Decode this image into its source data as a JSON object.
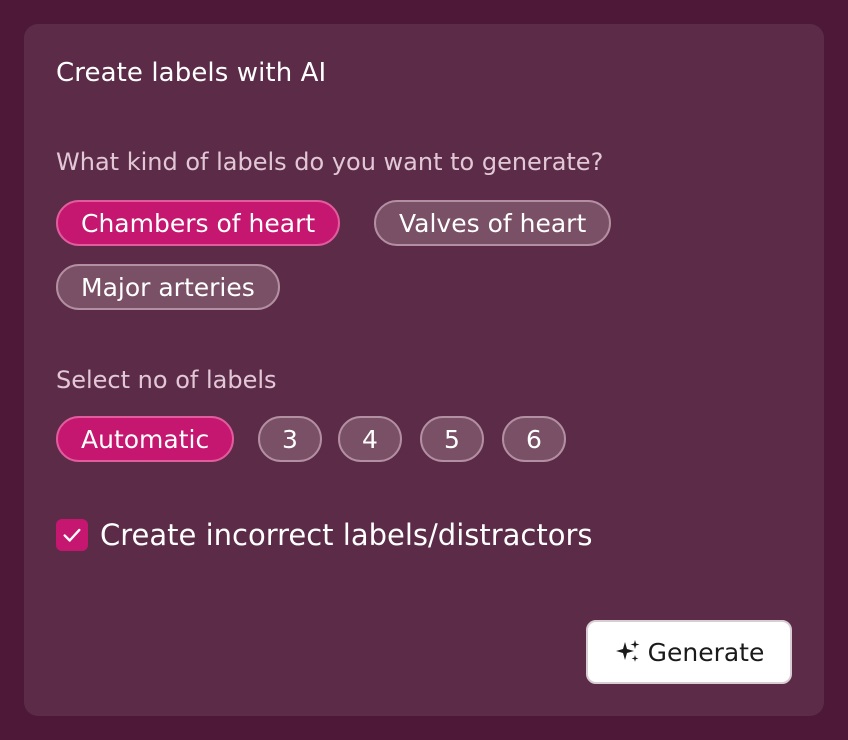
{
  "dialog": {
    "title": "Create labels with AI"
  },
  "label_kind": {
    "question": "What kind of labels do you want to generate?",
    "options": [
      {
        "label": "Chambers of heart",
        "selected": true
      },
      {
        "label": "Valves of heart",
        "selected": false
      },
      {
        "label": "Major arteries",
        "selected": false
      }
    ]
  },
  "label_count": {
    "question": "Select no of labels",
    "options": [
      {
        "label": "Automatic",
        "selected": true
      },
      {
        "label": "3",
        "selected": false
      },
      {
        "label": "4",
        "selected": false
      },
      {
        "label": "5",
        "selected": false
      },
      {
        "label": "6",
        "selected": false
      }
    ]
  },
  "distractors": {
    "label": "Create incorrect labels/distractors",
    "checked": true,
    "icon": "check-icon"
  },
  "actions": {
    "generate_label": "Generate",
    "generate_icon": "sparkle-icon"
  },
  "colors": {
    "outer_background": "#4e1838",
    "card_background": "#5c2b48",
    "accent": "#c5176f",
    "chip_unselected": "#7a5066"
  }
}
